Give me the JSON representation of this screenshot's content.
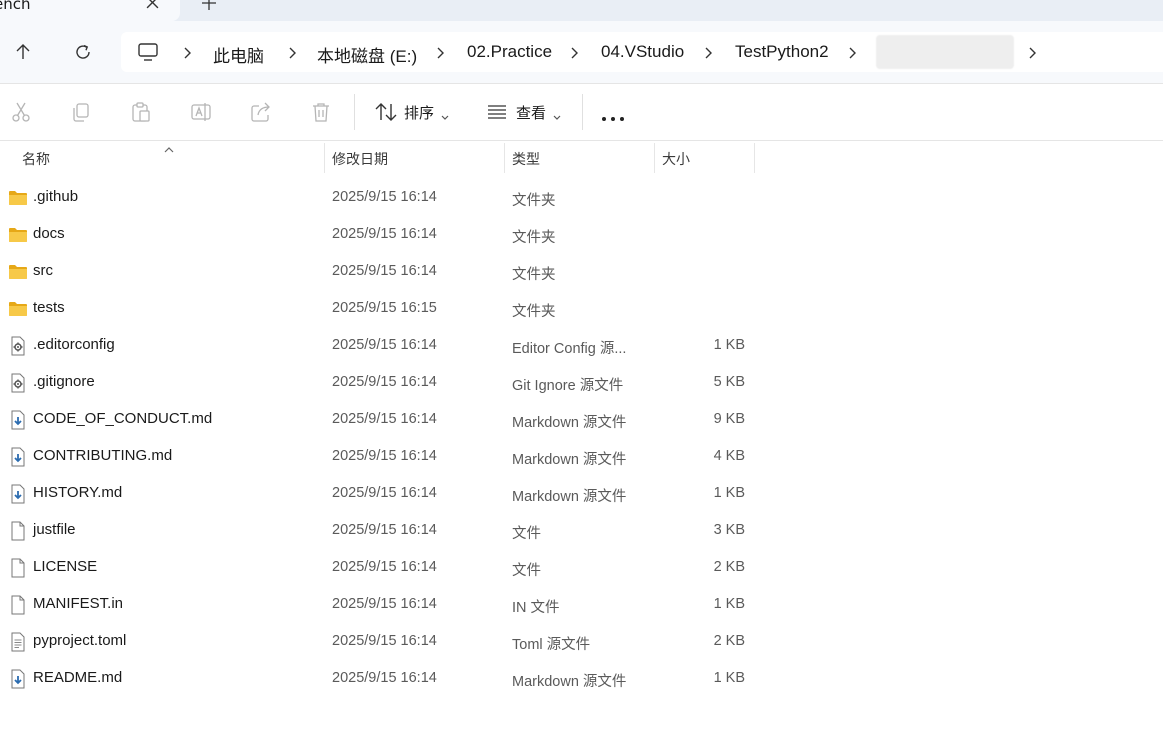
{
  "tab": {
    "title": "ench",
    "close_icon": "close-icon",
    "new_tab_icon": "plus-icon"
  },
  "nav": {
    "back_icon": "arrow-up-icon",
    "refresh_icon": "refresh-icon",
    "breadcrumbs": [
      "此电脑",
      "本地磁盘 (E:)",
      "02.Practice",
      "04.VStudio",
      "TestPython2"
    ],
    "root_icon": "monitor-icon"
  },
  "commandbar": {
    "sort_label": "排序",
    "view_label": "查看"
  },
  "columns": {
    "name": "名称",
    "modified": "修改日期",
    "type": "类型",
    "size": "大小"
  },
  "files": [
    {
      "name": ".github",
      "modified": "2025/9/15 16:14",
      "type": "文件夹",
      "size": "",
      "kind": "folder"
    },
    {
      "name": "docs",
      "modified": "2025/9/15 16:14",
      "type": "文件夹",
      "size": "",
      "kind": "folder"
    },
    {
      "name": "src",
      "modified": "2025/9/15 16:14",
      "type": "文件夹",
      "size": "",
      "kind": "folder"
    },
    {
      "name": "tests",
      "modified": "2025/9/15 16:15",
      "type": "文件夹",
      "size": "",
      "kind": "folder"
    },
    {
      "name": ".editorconfig",
      "modified": "2025/9/15 16:14",
      "type": "Editor Config 源...",
      "size": "1 KB",
      "kind": "config"
    },
    {
      "name": ".gitignore",
      "modified": "2025/9/15 16:14",
      "type": "Git Ignore 源文件",
      "size": "5 KB",
      "kind": "config"
    },
    {
      "name": "CODE_OF_CONDUCT.md",
      "modified": "2025/9/15 16:14",
      "type": "Markdown 源文件",
      "size": "9 KB",
      "kind": "markdown"
    },
    {
      "name": "CONTRIBUTING.md",
      "modified": "2025/9/15 16:14",
      "type": "Markdown 源文件",
      "size": "4 KB",
      "kind": "markdown"
    },
    {
      "name": "HISTORY.md",
      "modified": "2025/9/15 16:14",
      "type": "Markdown 源文件",
      "size": "1 KB",
      "kind": "markdown"
    },
    {
      "name": "justfile",
      "modified": "2025/9/15 16:14",
      "type": "文件",
      "size": "3 KB",
      "kind": "file"
    },
    {
      "name": "LICENSE",
      "modified": "2025/9/15 16:14",
      "type": "文件",
      "size": "2 KB",
      "kind": "file"
    },
    {
      "name": "MANIFEST.in",
      "modified": "2025/9/15 16:14",
      "type": "IN 文件",
      "size": "1 KB",
      "kind": "file"
    },
    {
      "name": "pyproject.toml",
      "modified": "2025/9/15 16:14",
      "type": "Toml 源文件",
      "size": "2 KB",
      "kind": "text"
    },
    {
      "name": "README.md",
      "modified": "2025/9/15 16:14",
      "type": "Markdown 源文件",
      "size": "1 KB",
      "kind": "markdown"
    }
  ],
  "colors": {
    "folder": "#f7c948",
    "folder_dark": "#e6a817",
    "markdown_badge": "#2b6cb0",
    "chrome_bg": "#f7f9fc",
    "tabstrip_bg": "#e9eef5"
  }
}
